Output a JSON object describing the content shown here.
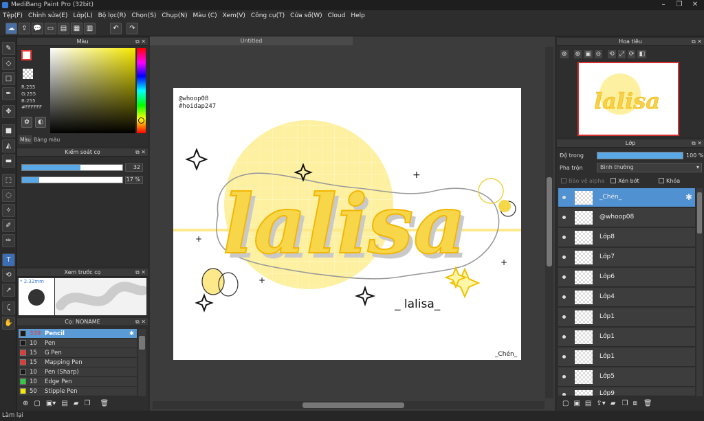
{
  "window": {
    "title": "MediBang Paint Pro (32bit)"
  },
  "menu": [
    "Tệp(F)",
    "Chỉnh sửa(E)",
    "Lớp(L)",
    "Bộ lọc(R)",
    "Chọn(S)",
    "Chụp(N)",
    "Màu (C)",
    "Xem(V)",
    "Công cụ(T)",
    "Cửa sổ(W)",
    "Cloud",
    "Help"
  ],
  "color_panel": {
    "title": "Màu",
    "rgb_r": "R:255",
    "rgb_g": "G:255",
    "rgb_b": "B:255",
    "hex": "#FFFFFF",
    "tab_color": "Màu",
    "tab_palette": "Bảng màu"
  },
  "brush_control": {
    "title": "Kiểm soát cọ",
    "size_value": "32",
    "size_fraction": 0.58,
    "opacity_value": "17 %",
    "opacity_fraction": 0.17
  },
  "brush_preview": {
    "title": "Xem trước cọ",
    "size_label": "* 2.32mm"
  },
  "brush_list": {
    "title": "Cọ: NONAME",
    "items": [
      {
        "size": "339",
        "name": "Pencil",
        "color": "#1a1a1a",
        "selected": true
      },
      {
        "size": "10",
        "name": "Pen",
        "color": "#1a1a1a"
      },
      {
        "size": "15",
        "name": "G Pen",
        "color": "#e53935"
      },
      {
        "size": "15",
        "name": "Mapping Pen",
        "color": "#e53935"
      },
      {
        "size": "10",
        "name": "Pen (Sharp)",
        "color": "#1a1a1a"
      },
      {
        "size": "10",
        "name": "Edge Pen",
        "color": "#2ecc40"
      },
      {
        "size": "50",
        "name": "Stipple Pen",
        "color": "#f5e800"
      }
    ]
  },
  "document": {
    "tab": "Untitled",
    "watermark1": "@whoop08",
    "watermark2": "#hoidap247",
    "main_text": "lalisa",
    "sub_text": "_ lalisa_",
    "signature": "_Chén_"
  },
  "navigator": {
    "title": "Hoa tiêu"
  },
  "layers": {
    "title": "Lớp",
    "opacity_label": "Độ trong",
    "opacity_value": "100 %",
    "opacity_fraction": 1.0,
    "blend_label": "Pha trộn",
    "blend_value": "Bình thường",
    "protect_alpha": "Bảo vệ alpha",
    "clip": "Xén bớt",
    "lock": "Khóa",
    "items": [
      {
        "name": "_Chén_",
        "selected": true
      },
      {
        "name": "@whoop08"
      },
      {
        "name": "Lớp8"
      },
      {
        "name": "Lớp7"
      },
      {
        "name": "Lớp6"
      },
      {
        "name": "Lớp4"
      },
      {
        "name": "Lớp1"
      },
      {
        "name": "Lớp1"
      },
      {
        "name": "Lớp1"
      },
      {
        "name": "Lớp5"
      },
      {
        "name": "Lớp9"
      }
    ]
  },
  "status": {
    "text": "Làm lại"
  }
}
